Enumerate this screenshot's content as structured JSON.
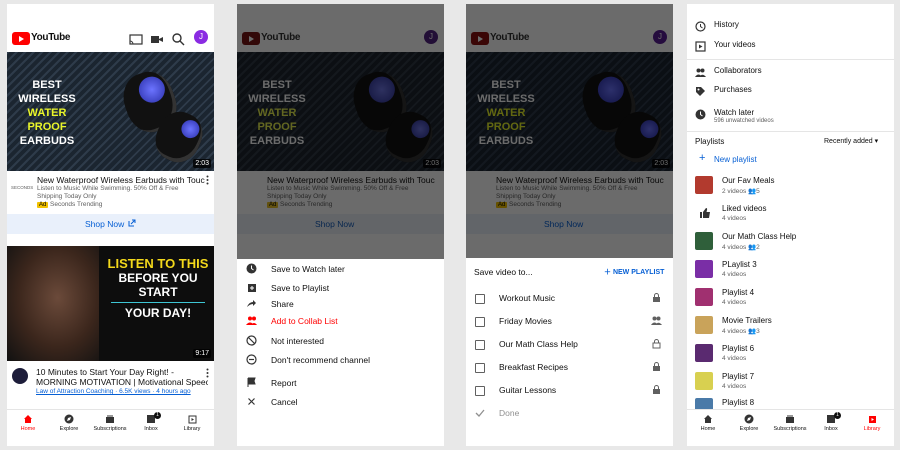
{
  "app": {
    "name": "YouTube",
    "avatar_letter": "J"
  },
  "colors": {
    "brand": "#ff0000",
    "link": "#065fd4",
    "accent_yellow": "#f2c200",
    "dim_overlay": "rgba(0,0,0,0.58)"
  },
  "topbar_icons": [
    "cast-icon",
    "camera-icon",
    "search-icon"
  ],
  "ad": {
    "thumb_lines": [
      "BEST",
      "WIRELESS",
      "WATER",
      "PROOF",
      "EARBUDS"
    ],
    "duration": "2:03",
    "title": "New Waterproof Wireless Earbuds with Touc...",
    "description_1": "Listen to Music While Swimming. 50% Off & Free",
    "description_2": "Shipping Today Only",
    "channel_short": "SECONDS",
    "ad_badge": "Ad",
    "channel": "Seconds Trending",
    "shop_label": "Shop Now"
  },
  "video": {
    "thumb_lines": [
      "LISTEN TO THIS",
      "BEFORE YOU START",
      "YOUR DAY!"
    ],
    "duration": "9:17",
    "title_1": "10 Minutes to Start Your Day Right! -",
    "title_2": "MORNING MOTIVATION | Motivational Speec...",
    "meta": "Law of Attraction Coaching · 6.5K views · 4 hours ago"
  },
  "bottom_nav": [
    {
      "label": "Home"
    },
    {
      "label": "Explore"
    },
    {
      "label": "Subscriptions"
    },
    {
      "label": "Inbox",
      "badge": "1"
    },
    {
      "label": "Library"
    }
  ],
  "action_sheet": [
    {
      "label": "Save to Watch later",
      "icon": "clock-icon"
    },
    {
      "label": "Save to Playlist",
      "icon": "playlist-add-icon"
    },
    {
      "label": "Share",
      "icon": "share-icon"
    },
    {
      "label": "Add to Collab List",
      "icon": "collab-icon",
      "highlight": true
    },
    {
      "label": "Not interested",
      "icon": "block-icon"
    },
    {
      "label": "Don't recommend channel",
      "icon": "minus-circle-icon"
    },
    {
      "label": "Report",
      "icon": "flag-icon"
    },
    {
      "label": "Cancel",
      "icon": "close-icon"
    }
  ],
  "save_dialog": {
    "title": "Save video to...",
    "new_playlist": "NEW PLAYLIST",
    "playlists": [
      {
        "label": "Workout Music",
        "privacy": "lock-icon"
      },
      {
        "label": "Friday Movies",
        "privacy": "people-icon"
      },
      {
        "label": "Our Math Class Help",
        "privacy": "collab-lock-icon"
      },
      {
        "label": "Breakfast Recipes",
        "privacy": "lock-icon"
      },
      {
        "label": "Guitar Lessons",
        "privacy": "lock-icon"
      }
    ],
    "done": "Done"
  },
  "library": {
    "items": [
      {
        "label": "History",
        "icon": "history-icon"
      },
      {
        "label": "Your videos",
        "icon": "play-square-icon"
      },
      {
        "label": "Collaborators",
        "icon": "people-icon"
      },
      {
        "label": "Purchases",
        "icon": "tag-icon"
      },
      {
        "label": "Watch later",
        "icon": "clock-icon",
        "sub": "596 unwatched videos"
      }
    ],
    "playlists_label": "Playlists",
    "sort_label": "Recently added",
    "new_playlist": "New playlist",
    "playlists": [
      {
        "label": "Our Fav Meals",
        "count": "2 videos",
        "collab": "5",
        "color": "#b23a2e"
      },
      {
        "label": "Liked videos",
        "count": "4 videos",
        "icon": "thumb-up-icon"
      },
      {
        "label": "Our Math Class Help",
        "count": "4 videos",
        "collab": "2",
        "color": "#2f5f3a"
      },
      {
        "label": "PLaylist 3",
        "count": "4 videos",
        "color": "#7a2ea6"
      },
      {
        "label": "Playlist 4",
        "count": "4 videos",
        "color": "#a03070"
      },
      {
        "label": "Movie Trailers",
        "count": "4 videos",
        "collab": "3",
        "color": "#c9a35a"
      },
      {
        "label": "Playlist 6",
        "count": "4 videos",
        "color": "#5a2a70"
      },
      {
        "label": "Playlist 7",
        "count": "4 videos",
        "color": "#d8d050"
      },
      {
        "label": "Playlist 8",
        "count": "",
        "color": "#4a7aa8"
      }
    ]
  }
}
